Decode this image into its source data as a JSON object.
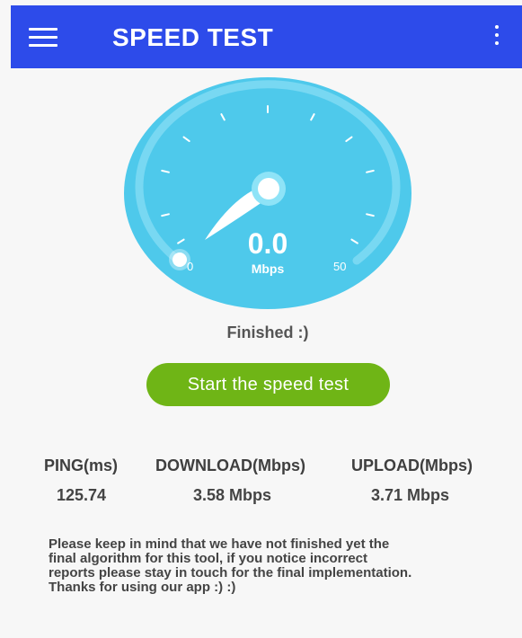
{
  "app_bar": {
    "title": "SPEED TEST",
    "menu_icon": "hamburger-menu-icon",
    "more_icon": "more-vert-icon",
    "color": "#2d4bea"
  },
  "gauge": {
    "value": "0.0",
    "unit": "Mbps",
    "min_label": "0",
    "max_label": "50",
    "needle_fraction": 0.0,
    "color": "#4ec9eb",
    "ring_color": "#78d8f2"
  },
  "status_text": "Finished :)",
  "start_button": {
    "label": "Start the speed test",
    "color": "#6fb516"
  },
  "stats": {
    "ping": {
      "label": "PING(ms)",
      "value": "125.74"
    },
    "download": {
      "label": "DOWNLOAD(Mbps)",
      "value": "3.58 Mbps"
    },
    "upload": {
      "label": "UPLOAD(Mbps)",
      "value": "3.71 Mbps"
    }
  },
  "notice": {
    "line1": "Please keep in mind that we have not finished yet the",
    "line2": "final algorithm for this tool, if you notice incorrect",
    "line3": "reports please stay in touch for the final implementation.",
    "line4": "Thanks for using our app :) :)"
  }
}
